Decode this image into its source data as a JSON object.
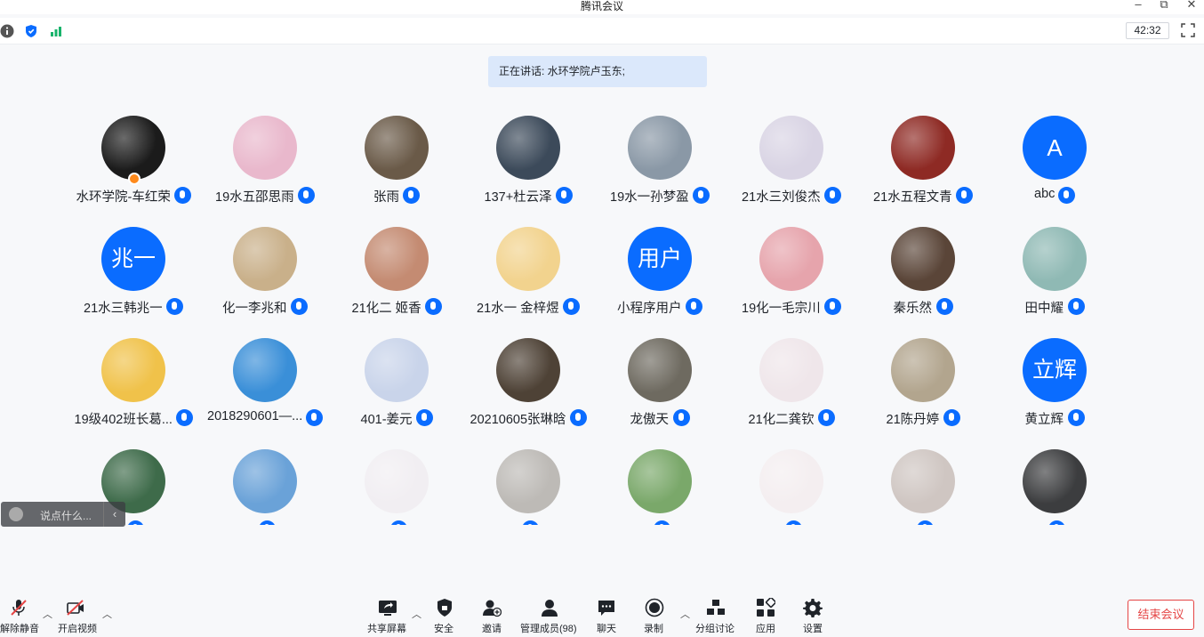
{
  "window": {
    "title": "腾讯会议",
    "timer": "42:32"
  },
  "speaking": "正在讲话: 水环学院卢玉东;",
  "participants": [
    {
      "name": "水环学院-车红荣",
      "avatar": "photo",
      "color": "#1b1b1b",
      "host": true
    },
    {
      "name": "19水五邵思雨",
      "avatar": "photo",
      "color": "#e9b8cc"
    },
    {
      "name": "张雨",
      "avatar": "photo",
      "color": "#6a5a48"
    },
    {
      "name": "137+杜云泽",
      "avatar": "photo",
      "color": "#3c4a5a"
    },
    {
      "name": "19水一孙梦盈",
      "avatar": "photo",
      "color": "#8a98a6"
    },
    {
      "name": "21水三刘俊杰",
      "avatar": "photo",
      "color": "#d9d4e4"
    },
    {
      "name": "21水五程文青",
      "avatar": "photo",
      "color": "#8e2a24"
    },
    {
      "name": "abc",
      "avatar": "text",
      "text": "A"
    },
    {
      "name": "21水三韩兆一",
      "avatar": "text",
      "text": "兆一"
    },
    {
      "name": "化一李兆和",
      "avatar": "photo",
      "color": "#c9b08a"
    },
    {
      "name": "21化二 姬香",
      "avatar": "photo",
      "color": "#c48b72"
    },
    {
      "name": "21水一 金梓煜",
      "avatar": "photo",
      "color": "#f2d38e"
    },
    {
      "name": "小程序用户",
      "avatar": "text",
      "text": "用户"
    },
    {
      "name": "19化一毛宗川",
      "avatar": "photo",
      "color": "#e6a4ac"
    },
    {
      "name": "秦乐然",
      "avatar": "photo",
      "color": "#5a4538"
    },
    {
      "name": "田中耀",
      "avatar": "photo",
      "color": "#8fb9b4"
    },
    {
      "name": "19级402班长葛...",
      "avatar": "photo",
      "color": "#f0c24a"
    },
    {
      "name": "2018290601—...",
      "avatar": "photo",
      "color": "#3a8fd8"
    },
    {
      "name": "401-姜元",
      "avatar": "photo",
      "color": "#c9d4ea"
    },
    {
      "name": "20210605张琳晗",
      "avatar": "photo",
      "color": "#4e4236"
    },
    {
      "name": "龙傲天",
      "avatar": "photo",
      "color": "#6e6a60"
    },
    {
      "name": "21化二龚钦",
      "avatar": "photo",
      "color": "#efe6ea"
    },
    {
      "name": "21陈丹婷",
      "avatar": "photo",
      "color": "#b2a58e"
    },
    {
      "name": "黄立辉",
      "avatar": "text",
      "text": "立辉"
    },
    {
      "name": "",
      "avatar": "photo",
      "color": "#3e6b4a"
    },
    {
      "name": "",
      "avatar": "photo",
      "color": "#6aa2d8"
    },
    {
      "name": "",
      "avatar": "photo",
      "color": "#f1eef2"
    },
    {
      "name": "",
      "avatar": "photo",
      "color": "#bdbab6"
    },
    {
      "name": "",
      "avatar": "photo",
      "color": "#7aa86a"
    },
    {
      "name": "",
      "avatar": "photo",
      "color": "#f4eef0"
    },
    {
      "name": "",
      "avatar": "photo",
      "color": "#cfc6c2"
    },
    {
      "name": "",
      "avatar": "photo",
      "color": "#3c3d3f"
    }
  ],
  "chat": {
    "placeholder": "说点什么..."
  },
  "toolbar": {
    "unmute": "解除静音",
    "video": "开启视频",
    "share": "共享屏幕",
    "security": "安全",
    "invite": "邀请",
    "members": "管理成员(98)",
    "chat": "聊天",
    "record": "录制",
    "breakout": "分组讨论",
    "apps": "应用",
    "settings": "设置",
    "end": "结束会议"
  },
  "colors": {
    "accent": "#0a6cff",
    "end": "#e54545"
  }
}
